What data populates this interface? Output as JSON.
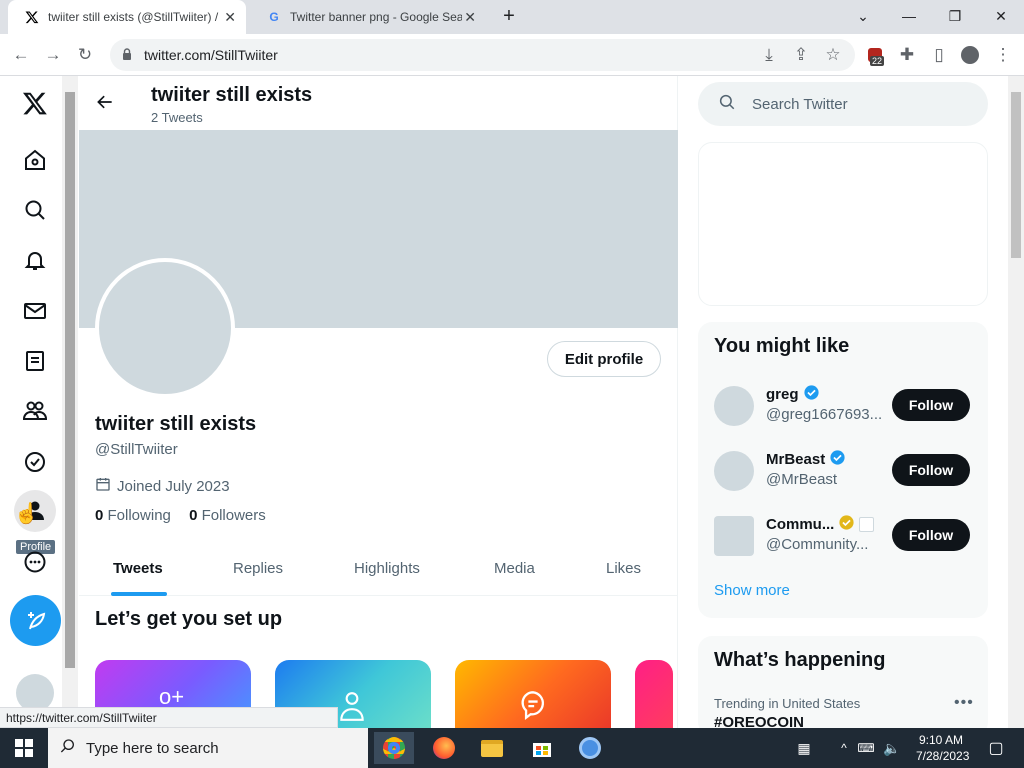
{
  "browser": {
    "tabs": [
      {
        "title": "twiiter still exists (@StillTwiiter) /",
        "active": true
      },
      {
        "title": "Twitter banner png - Google Sea",
        "active": false
      }
    ],
    "url": "twitter.com/StillTwiiter",
    "extension_badge": "22",
    "status_url": "https://twitter.com/StillTwiiter"
  },
  "nav": {
    "tooltip": "Profile"
  },
  "profile": {
    "header_name": "twiiter still exists",
    "tweet_count": "2 Tweets",
    "display_name": "twiiter still exists",
    "handle": "@StillTwiiter",
    "joined": "Joined July 2023",
    "following_count": "0",
    "following_label": "Following",
    "followers_count": "0",
    "followers_label": "Followers",
    "edit_profile": "Edit profile",
    "tabs": [
      "Tweets",
      "Replies",
      "Highlights",
      "Media",
      "Likes"
    ],
    "setup_title": "Let’s get you set up"
  },
  "sidebar": {
    "search_placeholder": "Search Twitter",
    "you_might_like": "You might like",
    "suggestions": [
      {
        "name": "greg",
        "handle": "@greg1667693...",
        "verified": "blue"
      },
      {
        "name": "MrBeast",
        "handle": "@MrBeast",
        "verified": "blue"
      },
      {
        "name": "Commu...",
        "handle": "@Community...",
        "verified": "gold"
      }
    ],
    "follow_label": "Follow",
    "show_more": "Show more",
    "whats_happening": "What’s happening",
    "trend_label": "Trending in United States",
    "trend_name": "#OREOCOIN"
  },
  "taskbar": {
    "search_placeholder": "Type here to search",
    "time": "9:10 AM",
    "date": "7/28/2023"
  },
  "colors": {
    "accent": "#1d9bf0",
    "banner": "#cfd9de",
    "follow_button": "#0f1419"
  }
}
